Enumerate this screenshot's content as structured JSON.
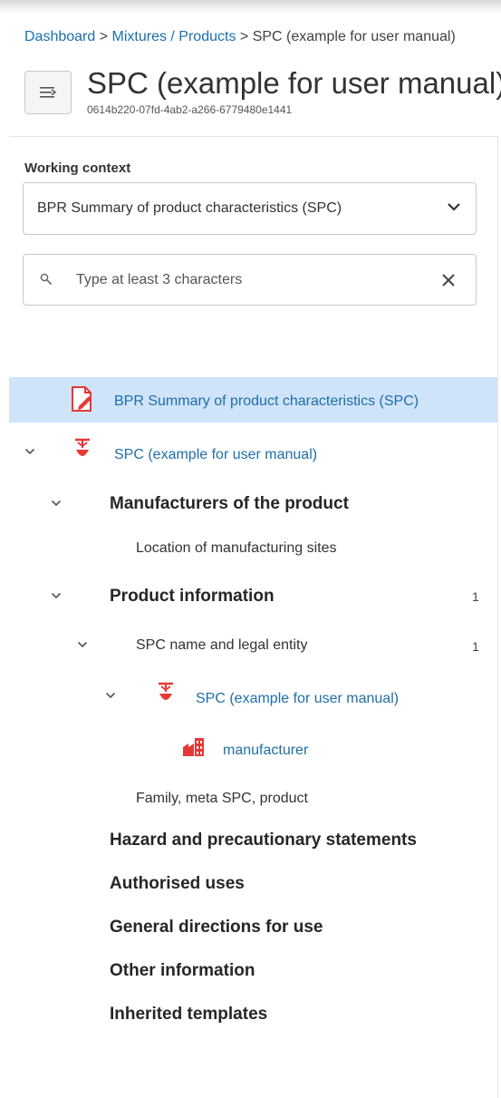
{
  "breadcrumb": {
    "dashboard": "Dashboard",
    "sep1": " > ",
    "mixtures": "Mixtures / Products",
    "sep2": " > ",
    "current": "SPC (example for user manual)"
  },
  "header": {
    "title": "SPC (example for user manual)",
    "uuid": "0614b220-07fd-4ab2-a266-6779480e1441"
  },
  "working_context": {
    "label": "Working context",
    "selected": "BPR Summary of product characteristics (SPC)"
  },
  "search": {
    "placeholder": "Type at least 3 characters",
    "value": ""
  },
  "tree": {
    "root_doc": "BPR Summary of product characteristics (SPC)",
    "spc_node": "SPC (example for user manual)",
    "manufacturers": "Manufacturers of the product",
    "location_sites": "Location of manufacturing sites",
    "product_info": "Product information",
    "product_info_count": "1",
    "spc_name_entity": "SPC name and legal entity",
    "spc_name_entity_count": "1",
    "spc_child": "SPC (example for user manual)",
    "manufacturer": "manufacturer",
    "family_meta": "Family, meta SPC, product",
    "hazard": "Hazard and precautionary statements",
    "authorised_uses": "Authorised uses",
    "general_directions": "General directions for use",
    "other_info": "Other information",
    "inherited_templates": "Inherited templates"
  },
  "colors": {
    "link": "#1e6fa8",
    "selected_row": "#cfe3f9",
    "icon_red": "#e53935"
  },
  "icons": [
    "menu-icon",
    "chevron-down-icon",
    "search-icon",
    "close-icon",
    "edit-document-icon",
    "mixture-icon",
    "factory-icon"
  ]
}
